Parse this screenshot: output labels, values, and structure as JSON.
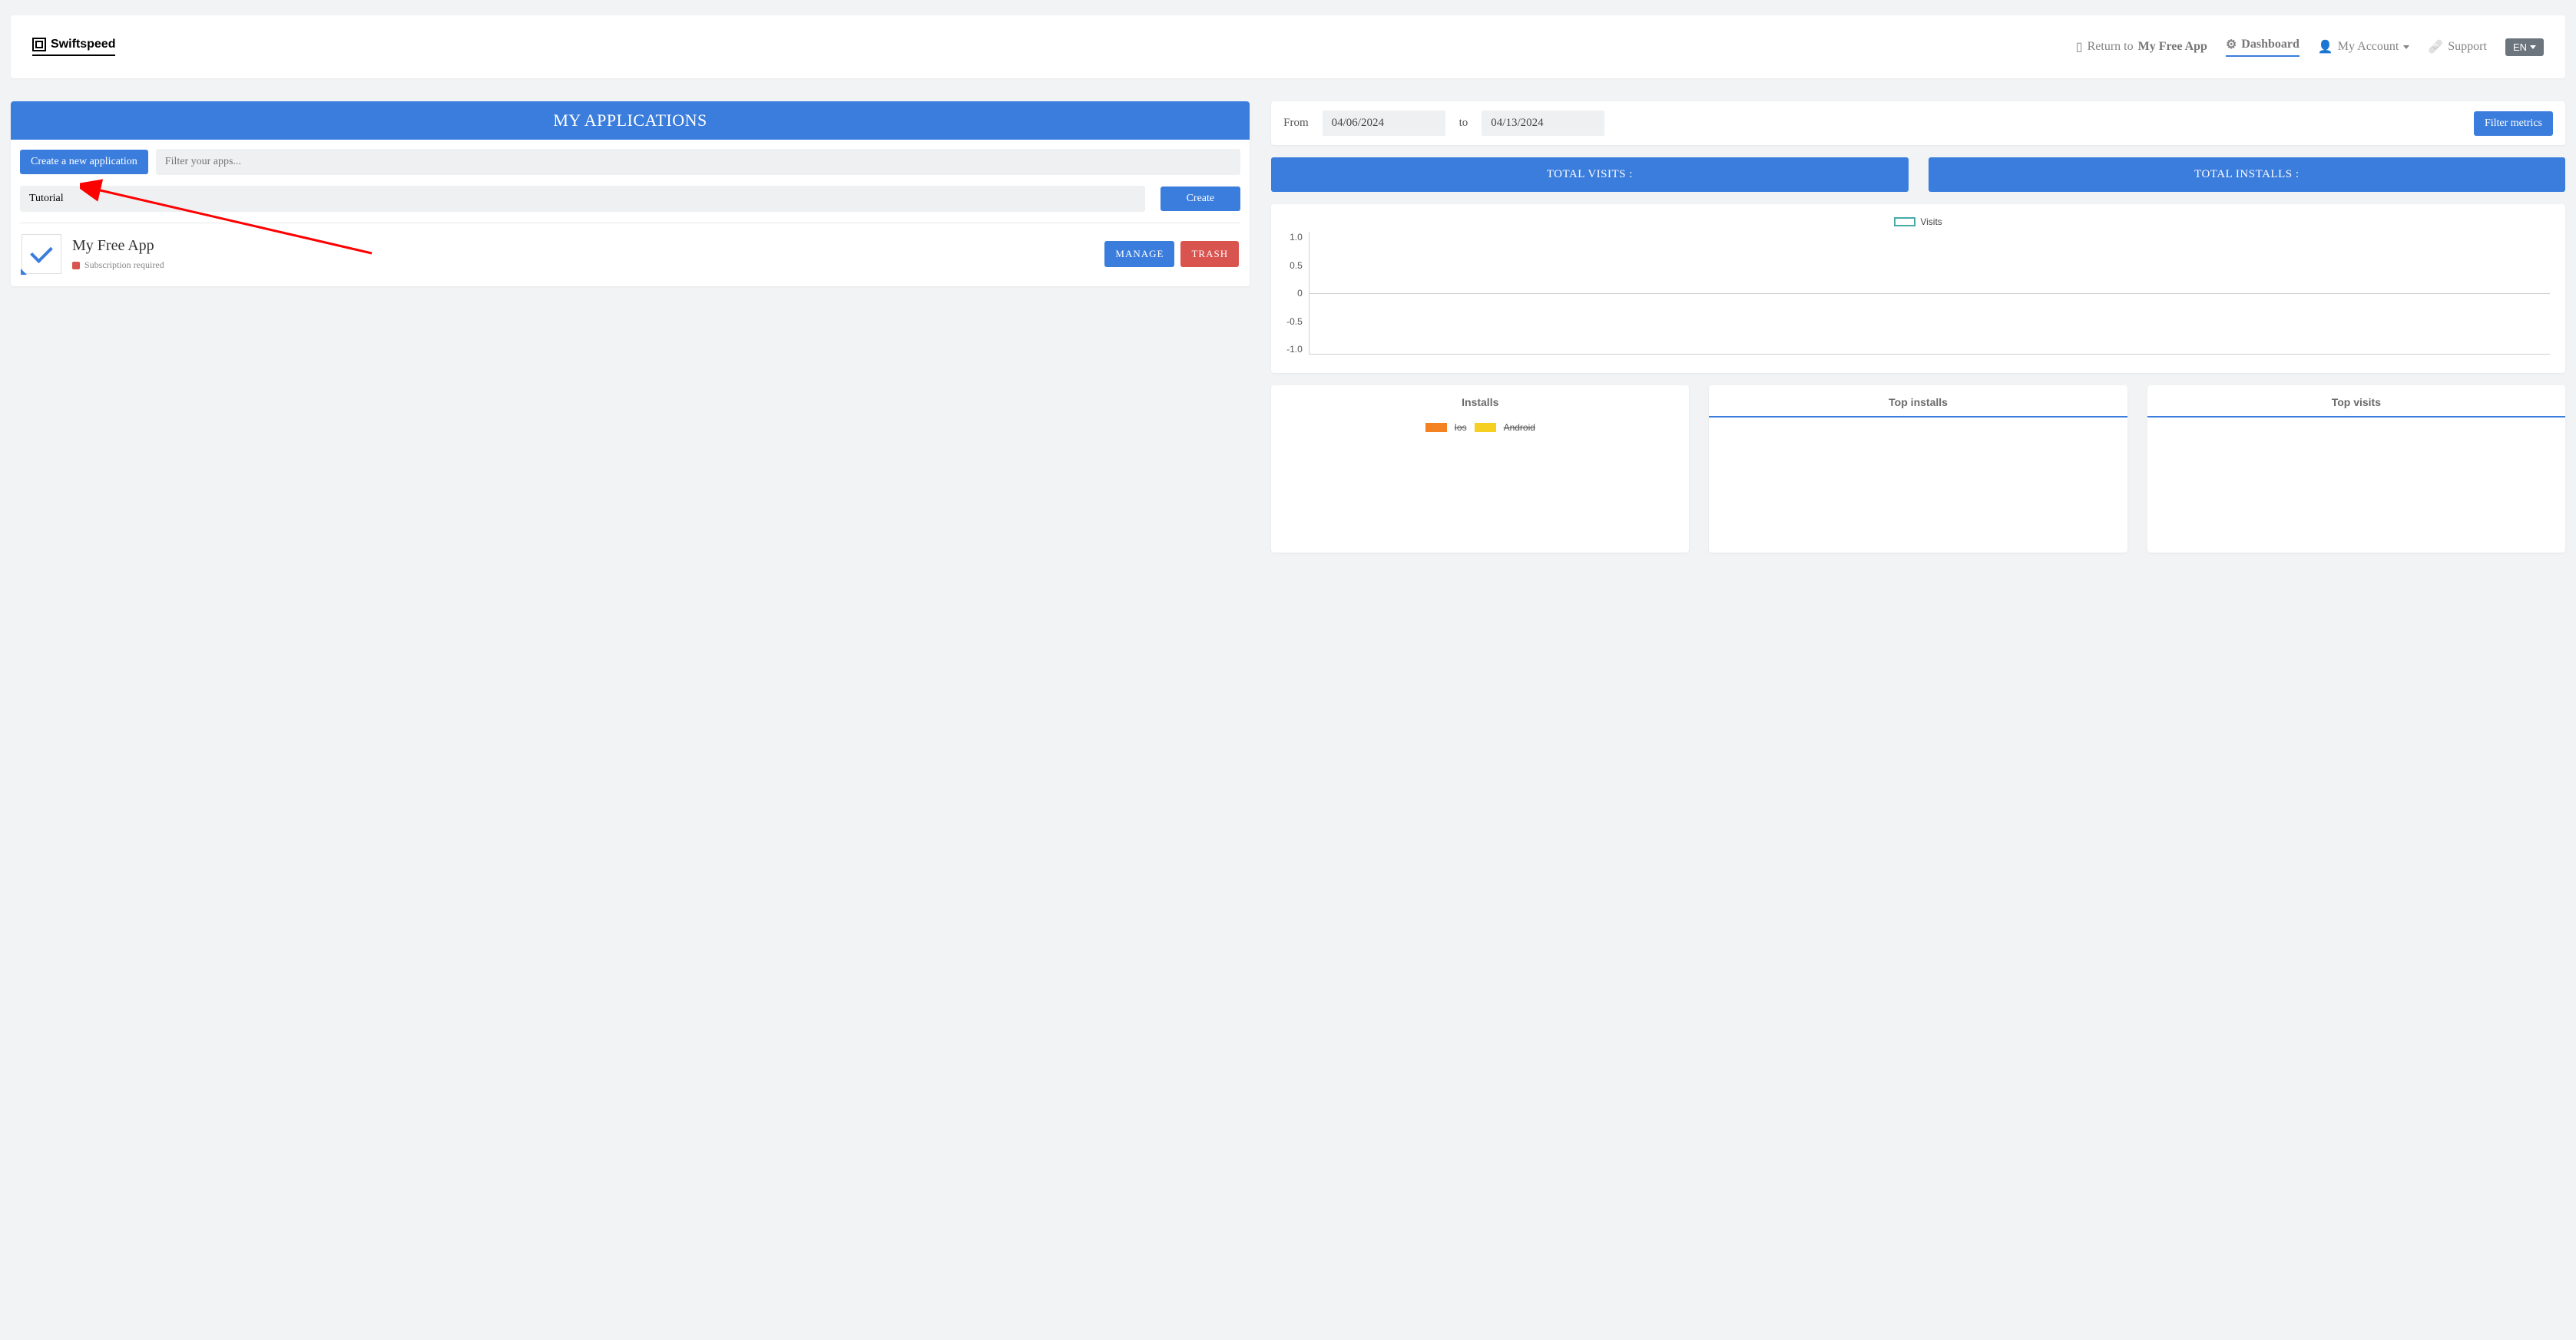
{
  "brand": "Swiftspeed",
  "nav": {
    "return_prefix": "Return to ",
    "return_app": "My Free App",
    "dashboard": "Dashboard",
    "account": "My Account",
    "support": "Support",
    "lang": "EN"
  },
  "apps_panel": {
    "title": "MY APPLICATIONS",
    "create_new": "Create a new application",
    "filter_placeholder": "Filter your apps...",
    "name_value": "Tutorial",
    "create_btn": "Create"
  },
  "app": {
    "name": "My Free App",
    "sub_required": "Subscription required",
    "manage": "MANAGE",
    "trash": "TRASH"
  },
  "dates": {
    "from_label": "From",
    "from_value": "04/06/2024",
    "to_label": "to",
    "to_value": "04/13/2024",
    "filter_btn": "Filter metrics"
  },
  "tiles": {
    "visits": "TOTAL VISITS :",
    "installs": "TOTAL INSTALLS :"
  },
  "chart": {
    "legend": "Visits"
  },
  "chart_data": {
    "type": "line",
    "series": [
      {
        "name": "Visits",
        "values": []
      }
    ],
    "y_ticks": [
      "1.0",
      "0.5",
      "0",
      "-0.5",
      "-1.0"
    ],
    "ylim": [
      -1.0,
      1.0
    ]
  },
  "small": {
    "installs_title": "Installs",
    "top_installs": "Top installs",
    "top_visits": "Top visits",
    "ios": "Ios",
    "android": "Android"
  }
}
